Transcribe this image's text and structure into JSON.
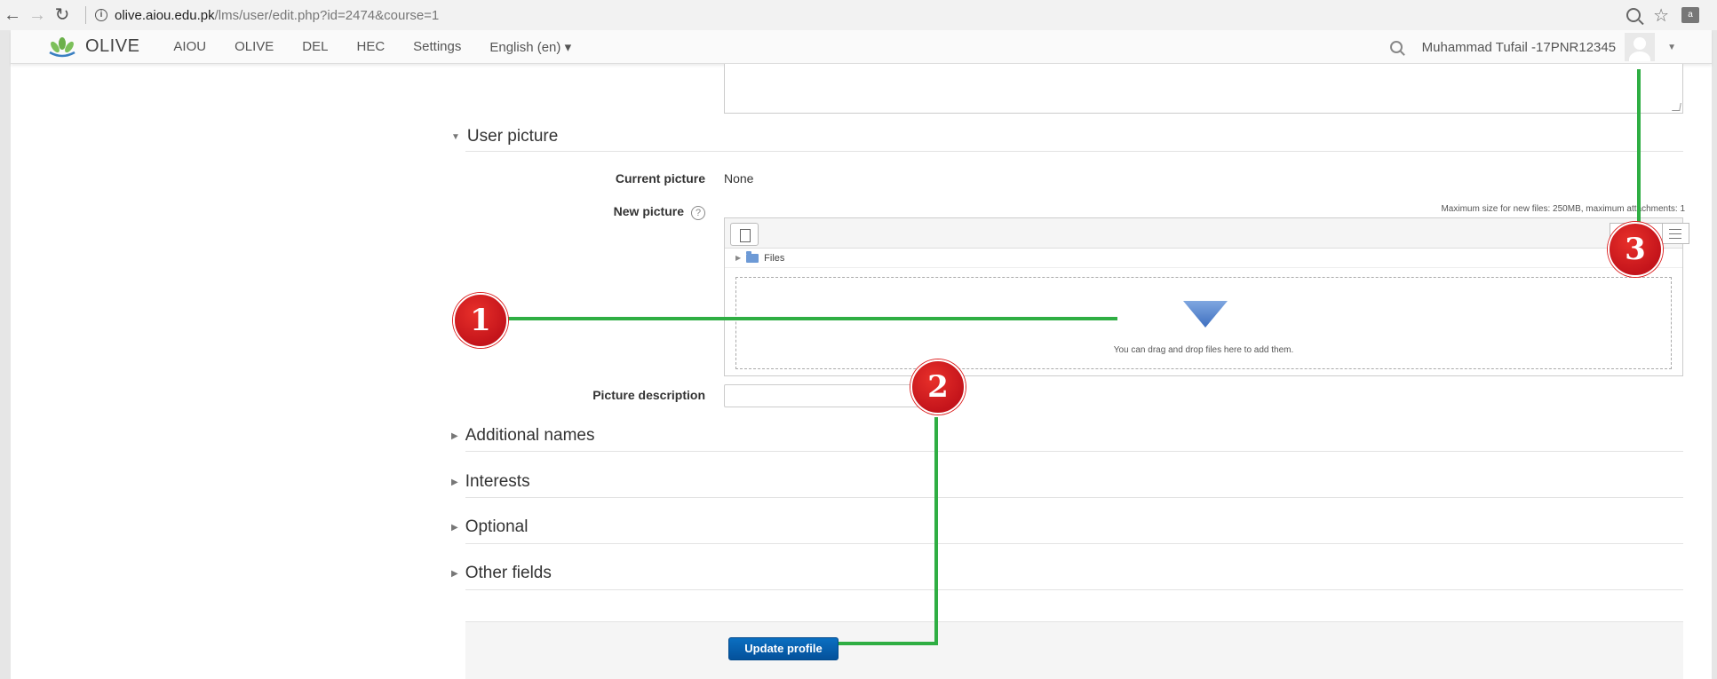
{
  "browser": {
    "url_host": "olive.aiou.edu.pk",
    "url_path": "/lms/user/edit.php?id=2474&course=1",
    "ext_label": "a"
  },
  "nav": {
    "logo_text": "OLIVE",
    "items": [
      "AIOU",
      "OLIVE",
      "DEL",
      "HEC",
      "Settings",
      "English (en) ▾"
    ],
    "user_name": "Muhammad Tufail -17PNR12345"
  },
  "form": {
    "user_picture_heading": "User picture",
    "current_picture_label": "Current picture",
    "current_picture_value": "None",
    "new_picture_label": "New picture",
    "max_size_text": "Maximum size for new files: 250MB, maximum attachments: 1",
    "files_label": "Files",
    "drop_text": "You can drag and drop files here to add them.",
    "picture_description_label": "Picture description",
    "picture_description_value": "",
    "sections": [
      "Additional names",
      "Interests",
      "Optional",
      "Other fields"
    ],
    "update_button": "Update profile"
  },
  "annotations": {
    "badges": [
      "1",
      "2",
      "3"
    ],
    "line_color": "#2fae43",
    "badge_color": "#d0161d"
  }
}
